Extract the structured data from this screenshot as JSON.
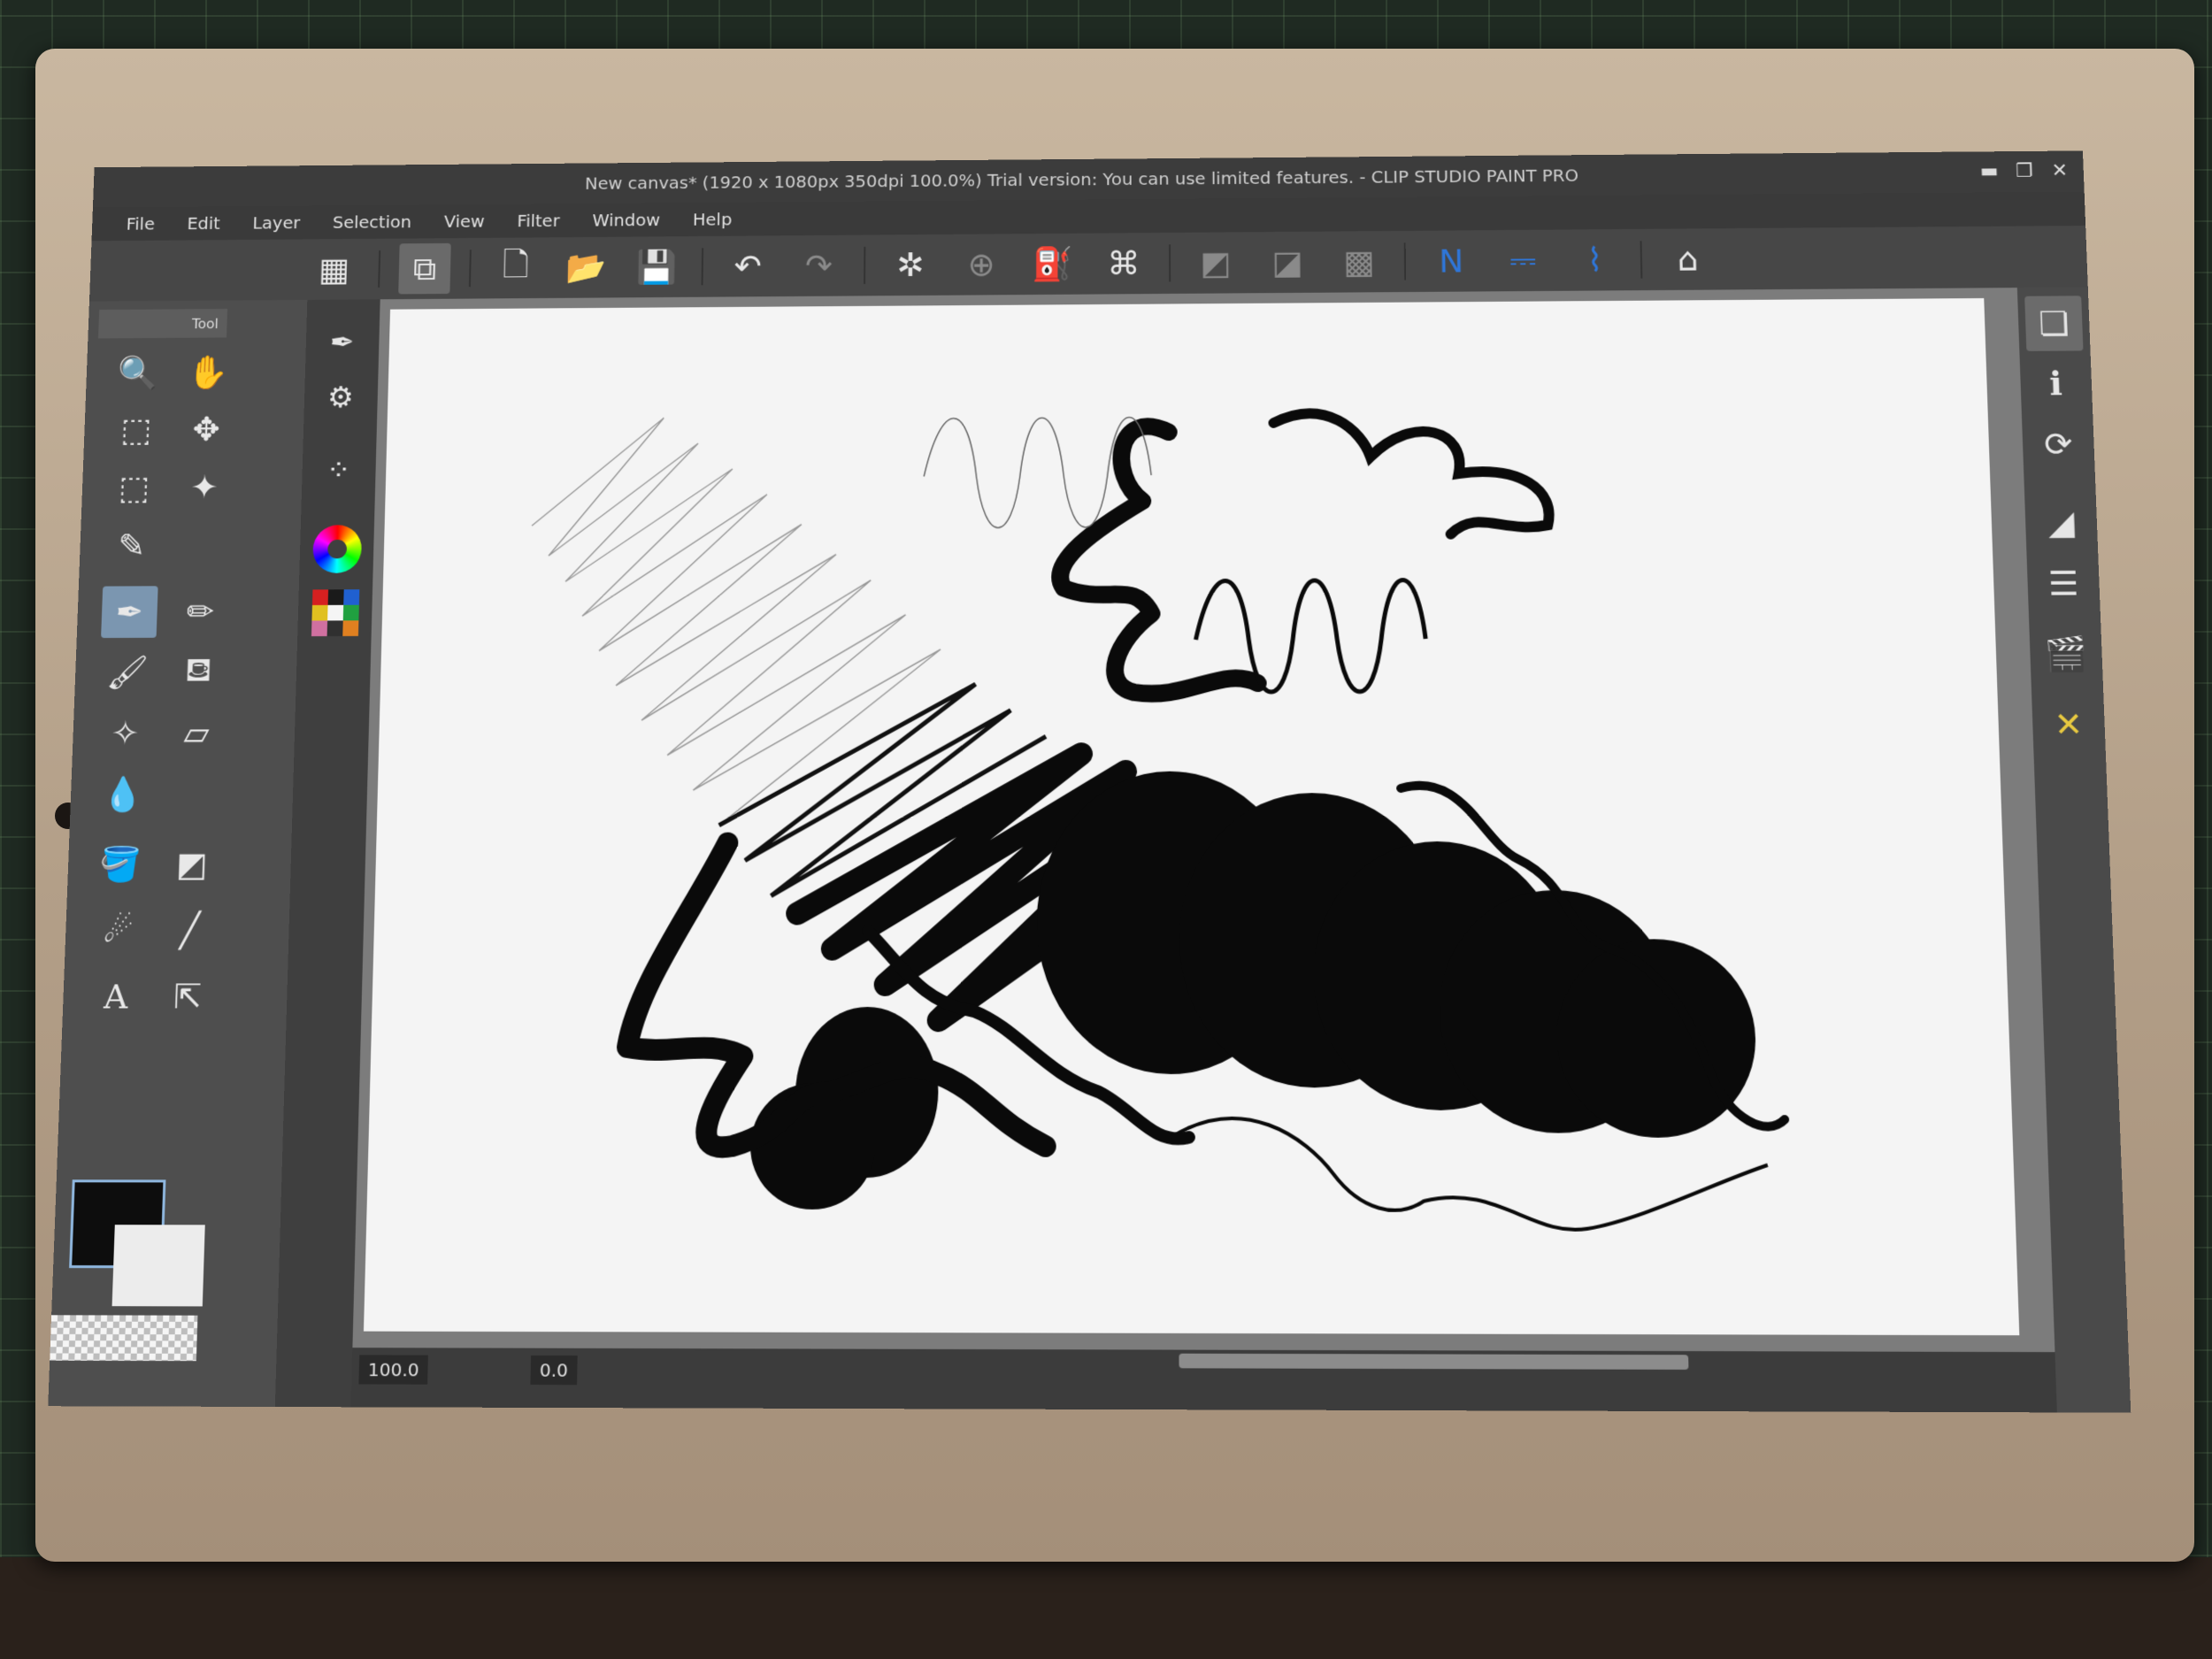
{
  "window": {
    "title": "New canvas* (1920 x 1080px 350dpi 100.0%)  Trial version: You can use limited features. - CLIP STUDIO PAINT PRO",
    "controls": [
      "▬",
      "❐",
      "✕"
    ]
  },
  "menu": [
    "File",
    "Edit",
    "Layer",
    "Selection",
    "View",
    "Filter",
    "Window",
    "Help"
  ],
  "command_bar": [
    {
      "name": "panel-layout-icon",
      "glyph": "▦"
    },
    {
      "name": "canvas-view-icon",
      "glyph": "⧉",
      "active": true
    },
    {
      "name": "new-canvas-icon",
      "glyph": "🗋"
    },
    {
      "name": "open-icon",
      "glyph": "📂"
    },
    {
      "name": "save-icon",
      "glyph": "💾"
    },
    {
      "name": "undo-icon",
      "glyph": "↶"
    },
    {
      "name": "redo-icon",
      "glyph": "↷"
    },
    {
      "name": "selection-launcher-icon",
      "glyph": "✲"
    },
    {
      "name": "transform-icon",
      "glyph": "⊕"
    },
    {
      "name": "fill-icon",
      "glyph": "⛽"
    },
    {
      "name": "free-transform-icon",
      "glyph": "⌘"
    },
    {
      "name": "clip-layer-icon",
      "glyph": "◩",
      "dim": true
    },
    {
      "name": "layer-mask-icon",
      "glyph": "◪",
      "dim": true
    },
    {
      "name": "grid-icon",
      "glyph": "▩",
      "dim": true
    },
    {
      "name": "ruler-snap-icon",
      "glyph": "N",
      "blue": true
    },
    {
      "name": "special-ruler-snap-icon",
      "glyph": "⎓",
      "blue": true
    },
    {
      "name": "grid-snap-icon",
      "glyph": "⌇",
      "blue": true
    },
    {
      "name": "reference-layer-icon",
      "glyph": "⌂"
    }
  ],
  "tool_panel": {
    "tab_label": "Tool",
    "tools": [
      {
        "name": "zoom-icon",
        "glyph": "🔍"
      },
      {
        "name": "hand-icon",
        "glyph": "✋"
      },
      {
        "name": "operation-icon",
        "glyph": "⬚"
      },
      {
        "name": "move-layer-icon",
        "glyph": "✥"
      },
      {
        "name": "selection-icon",
        "glyph": "⬚"
      },
      {
        "name": "auto-select-icon",
        "glyph": "✦"
      },
      {
        "name": "eyedropper-icon",
        "glyph": "✎"
      },
      {
        "name": "pen-icon",
        "glyph": "✒",
        "selected": true
      },
      {
        "name": "pencil-icon",
        "glyph": "✏"
      },
      {
        "name": "brush-icon",
        "glyph": "🖌"
      },
      {
        "name": "airbrush-icon",
        "glyph": "⛾"
      },
      {
        "name": "decoration-icon",
        "glyph": "✧"
      },
      {
        "name": "eraser-icon",
        "glyph": "▱"
      },
      {
        "name": "blend-icon",
        "glyph": "💧"
      },
      {
        "name": "fill-bucket-icon",
        "glyph": "🪣"
      },
      {
        "name": "gradient-icon",
        "glyph": "◩"
      },
      {
        "name": "contour-icon",
        "glyph": "☄"
      },
      {
        "name": "figure-icon",
        "glyph": "╱"
      },
      {
        "name": "text-icon",
        "glyph": "A"
      },
      {
        "name": "balloon-icon",
        "glyph": "⇱"
      }
    ]
  },
  "sub_panel": [
    {
      "name": "sub-tool-icon",
      "glyph": "✒"
    },
    {
      "name": "tool-property-icon",
      "glyph": "⚙"
    },
    {
      "name": "brush-size-icon",
      "glyph": "⁘"
    }
  ],
  "status": {
    "zoom_value": "100.0",
    "rotate_value": "0.0"
  },
  "right_dock": [
    {
      "name": "layer-property-icon",
      "glyph": "❏",
      "active": true
    },
    {
      "name": "navigator-icon",
      "glyph": "ℹ"
    },
    {
      "name": "sync-icon",
      "glyph": "⟳"
    },
    {
      "name": "layer-search-icon",
      "glyph": "◢"
    },
    {
      "name": "layer-icon",
      "glyph": "☰"
    },
    {
      "name": "animation-icon",
      "glyph": "🎬"
    },
    {
      "name": "material-icon",
      "glyph": "✕"
    }
  ],
  "colors": {
    "main": "#0d0d0d",
    "sub": "#ececec",
    "accent_blue": "#2f76d8",
    "color_set": [
      "#d62020",
      "#1a1a1a",
      "#2060d0",
      "#e0c020",
      "#f5f5f5",
      "#20a040",
      "#d070a0",
      "#303030",
      "#e08020"
    ]
  }
}
